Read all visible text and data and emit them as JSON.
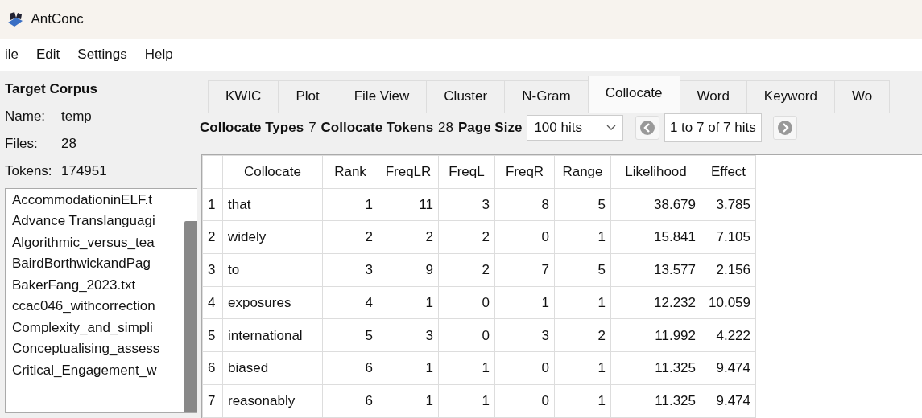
{
  "window": {
    "title": "AntConc"
  },
  "menu": [
    "ile",
    "Edit",
    "Settings",
    "Help"
  ],
  "corpus": {
    "heading": "Target Corpus",
    "name_label": "Name:",
    "name": "temp",
    "files_label": "Files:",
    "files": "28",
    "tokens_label": "Tokens:",
    "tokens": "174951",
    "files_list": [
      "AccommodationinELF.t",
      "Advance Translanguagi",
      "Algorithmic_versus_tea",
      "BairdBorthwickandPag",
      "BakerFang_2023.txt",
      "ccac046_withcorrection",
      "Complexity_and_simpli",
      "Conceptualising_assess",
      "Critical_Engagement_w"
    ]
  },
  "tabs": [
    {
      "label": "KWIC",
      "selected": false
    },
    {
      "label": "Plot",
      "selected": false
    },
    {
      "label": "File View",
      "selected": false
    },
    {
      "label": "Cluster",
      "selected": false
    },
    {
      "label": "N-Gram",
      "selected": false
    },
    {
      "label": "Collocate",
      "selected": true
    },
    {
      "label": "Word",
      "selected": false
    },
    {
      "label": "Keyword",
      "selected": false
    },
    {
      "label": "Wo",
      "selected": false
    }
  ],
  "toolbar": {
    "types_label": "Collocate Types",
    "types": "7",
    "tokens_label": "Collocate Tokens",
    "tokens": "28",
    "page_size_label": "Page Size",
    "page_size": "100 hits",
    "range": "1 to 7 of 7 hits"
  },
  "table": {
    "columns": [
      "",
      "Collocate",
      "Rank",
      "FreqLR",
      "FreqL",
      "FreqR",
      "Range",
      "Likelihood",
      "Effect"
    ],
    "rows": [
      [
        "1",
        "that",
        "1",
        "11",
        "3",
        "8",
        "5",
        "38.679",
        "3.785"
      ],
      [
        "2",
        "widely",
        "2",
        "2",
        "2",
        "0",
        "1",
        "15.841",
        "7.105"
      ],
      [
        "3",
        "to",
        "3",
        "9",
        "2",
        "7",
        "5",
        "13.577",
        "2.156"
      ],
      [
        "4",
        "exposures",
        "4",
        "1",
        "0",
        "1",
        "1",
        "12.232",
        "10.059"
      ],
      [
        "5",
        "international",
        "5",
        "3",
        "0",
        "3",
        "2",
        "11.992",
        "4.222"
      ],
      [
        "6",
        "biased",
        "6",
        "1",
        "1",
        "0",
        "1",
        "11.325",
        "9.474"
      ],
      [
        "7",
        "reasonably",
        "6",
        "1",
        "1",
        "0",
        "1",
        "11.325",
        "9.474"
      ]
    ]
  }
}
